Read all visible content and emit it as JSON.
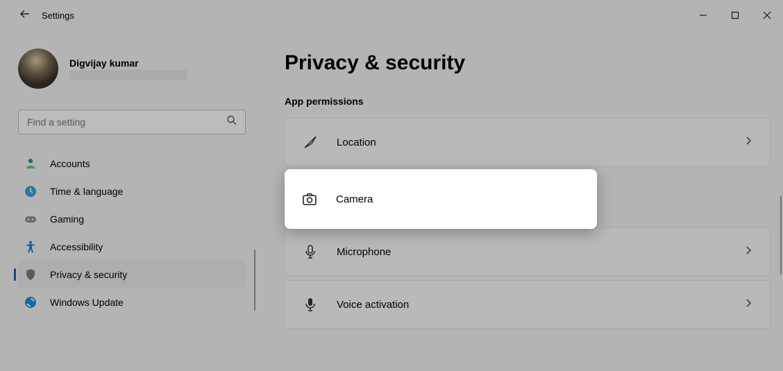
{
  "titlebar": {
    "back_label": "Back",
    "app_name": "Settings"
  },
  "user": {
    "name": "Digvijay kumar"
  },
  "search": {
    "placeholder": "Find a setting"
  },
  "sidebar": {
    "items": [
      {
        "icon": "accounts",
        "label": "Accounts",
        "selected": false
      },
      {
        "icon": "time",
        "label": "Time & language",
        "selected": false
      },
      {
        "icon": "gaming",
        "label": "Gaming",
        "selected": false
      },
      {
        "icon": "accessibility",
        "label": "Accessibility",
        "selected": false
      },
      {
        "icon": "privacy",
        "label": "Privacy & security",
        "selected": true
      },
      {
        "icon": "update",
        "label": "Windows Update",
        "selected": false
      }
    ]
  },
  "page": {
    "title": "Privacy & security",
    "section": "App permissions",
    "items": [
      {
        "icon": "location",
        "label": "Location",
        "highlight": false
      },
      {
        "icon": "camera",
        "label": "Camera",
        "highlight": true
      },
      {
        "icon": "microphone",
        "label": "Microphone",
        "highlight": false
      },
      {
        "icon": "voice",
        "label": "Voice activation",
        "highlight": false
      }
    ]
  }
}
